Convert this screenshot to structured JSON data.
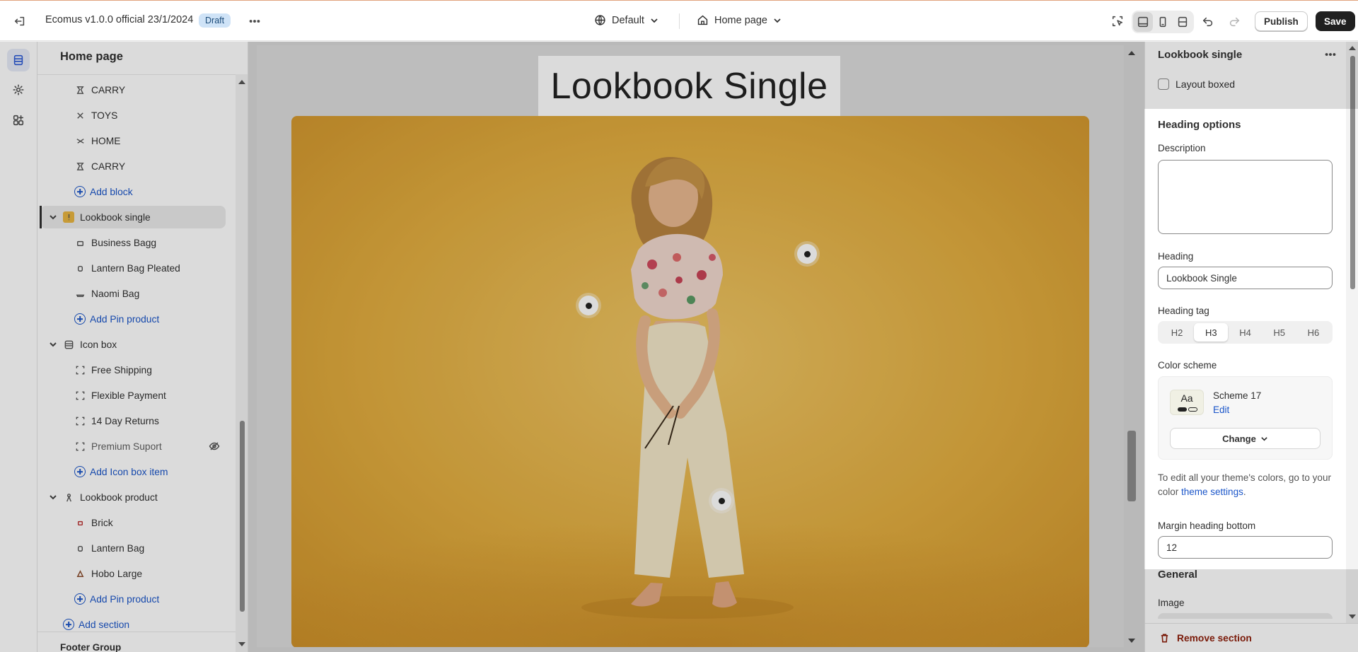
{
  "topbar": {
    "title": "Ecomus v1.0.0 official 23/1/2024",
    "status_badge": "Draft",
    "theme_select": "Default",
    "page_select": "Home page",
    "publish_label": "Publish",
    "save_label": "Save"
  },
  "sidebar": {
    "title": "Home page",
    "rows": [
      {
        "label": "CARRY"
      },
      {
        "label": "TOYS"
      },
      {
        "label": "HOME"
      },
      {
        "label": "CARRY"
      },
      {
        "label": "Add block"
      },
      {
        "label": "Lookbook single"
      },
      {
        "label": "Business Bagg"
      },
      {
        "label": "Lantern Bag Pleated"
      },
      {
        "label": "Naomi Bag"
      },
      {
        "label": "Add Pin product"
      },
      {
        "label": "Icon box"
      },
      {
        "label": "Free Shipping"
      },
      {
        "label": "Flexible Payment"
      },
      {
        "label": "14 Day Returns"
      },
      {
        "label": "Premium Suport"
      },
      {
        "label": "Add Icon box item"
      },
      {
        "label": "Lookbook product"
      },
      {
        "label": "Brick"
      },
      {
        "label": "Lantern Bag"
      },
      {
        "label": "Hobo Large"
      },
      {
        "label": "Add Pin product"
      },
      {
        "label": "Add section"
      }
    ],
    "footer_group": "Footer Group"
  },
  "preview": {
    "heading": "Lookbook Single"
  },
  "settings": {
    "title": "Lookbook single",
    "layout_boxed_label": "Layout boxed",
    "heading_options_title": "Heading options",
    "description_label": "Description",
    "description_value": "",
    "heading_label": "Heading",
    "heading_value": "Lookbook Single",
    "heading_tag_label": "Heading tag",
    "heading_tags": [
      "H2",
      "H3",
      "H4",
      "H5",
      "H6"
    ],
    "heading_tag_selected": "H3",
    "color_scheme_label": "Color scheme",
    "scheme_swatch_text": "Aa",
    "scheme_name": "Scheme 17",
    "scheme_edit": "Edit",
    "change_label": "Change",
    "help_text": "To edit all your theme's colors, go to your color",
    "help_link": "theme settings",
    "help_tail": ".",
    "margin_label": "Margin heading bottom",
    "margin_value": "12",
    "general_title": "General",
    "image_label": "Image",
    "remove_label": "Remove section"
  },
  "colors": {
    "accent_link": "#1a55c9",
    "danger": "#8e1f0b",
    "photo_background": "#e2ad3f"
  }
}
